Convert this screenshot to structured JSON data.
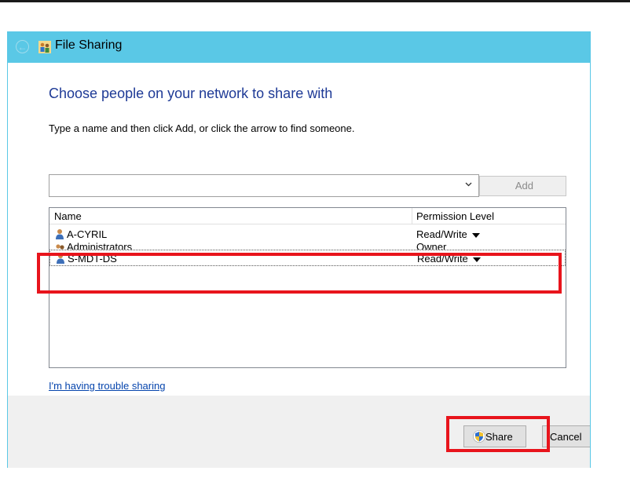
{
  "window": {
    "title": "File Sharing",
    "back_icon": "back-arrow-icon"
  },
  "content": {
    "heading": "Choose people on your network to share with",
    "instruction": "Type a name and then click Add, or click the arrow to find someone.",
    "name_input": {
      "value": "",
      "placeholder": ""
    },
    "add_label": "Add"
  },
  "list": {
    "columns": {
      "name": "Name",
      "permission": "Permission Level"
    },
    "rows": [
      {
        "name": "A-CYRIL",
        "permission": "Read/Write"
      },
      {
        "name": "Administrators",
        "permission": "Owner"
      },
      {
        "name": "S-MDT-DS",
        "permission": "Read/Write"
      }
    ]
  },
  "trouble_link": "I'm having trouble sharing",
  "footer": {
    "share_label": "Share",
    "cancel_label": "Cancel"
  },
  "colors": {
    "titlebar": "#5ac8e6",
    "heading": "#1e3a96",
    "highlight": "#e8141c",
    "link": "#0645ad"
  }
}
